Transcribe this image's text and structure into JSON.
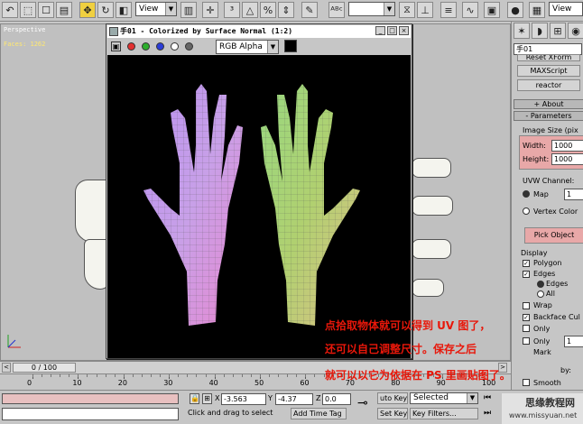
{
  "toolbar": {
    "view_dropdown": "View",
    "right_view_dropdown": "View"
  },
  "viewport": {
    "label": "Perspective",
    "faces": "Faces: 1262"
  },
  "render_window": {
    "title": "手01 - Colorized by Surface Normal (1:2)",
    "channel_dropdown": "RGB Alpha",
    "channel_dots": [
      "#e23030",
      "#2cae2c",
      "#2a3cd8",
      "#ffffff",
      "#666666"
    ]
  },
  "panel": {
    "object_name": "手01",
    "buttons": [
      "Reset XForm",
      "MAXScript",
      "reactor"
    ],
    "about_label": "About",
    "parameters_label": "Parameters",
    "image_size_label": "Image Size (pix",
    "width_label": "Width:",
    "width_value": "1000",
    "height_label": "Height:",
    "height_value": "1000",
    "uvw_channel_label": "UVW Channel:",
    "map_label": "Map",
    "map_value": "1",
    "vertex_color_label": "Vertex Color",
    "pick_object_label": "Pick Object",
    "display_label": "Display",
    "polygon_label": "Polygon",
    "edges_label": "Edges",
    "edges_sub_label": "Edges",
    "all_label": "All",
    "wrap_label": "Wrap",
    "backface_label": "Backface Cul",
    "only_label1": "Only",
    "only_label2": "Only",
    "only_value": "1",
    "mark_label": "Mark",
    "by_label": "by:",
    "smooth_label": "Smooth"
  },
  "timeline": {
    "frame": "0 / 100",
    "ticks": [
      "0",
      "10",
      "20",
      "30",
      "40",
      "50",
      "60",
      "70",
      "80",
      "90",
      "100"
    ]
  },
  "status": {
    "x_label": "X",
    "x_value": "-3.563",
    "y_label": "Y",
    "y_value": "-4.37",
    "z_label": "Z",
    "z_value": "0.0",
    "prompt": "Click and drag to select",
    "add_time_tag": "Add Time Tag",
    "auto_key": "uto Key",
    "selected": "Selected",
    "set_key": "Set Key",
    "key_filters": "Key Filters..."
  },
  "annotation": {
    "line1": "点拾取物体就可以得到 UV 图了，",
    "line2": "还可以自己调整尺寸。保存之后",
    "line3": "就可以以它为依据在 PS 里画贴图了。"
  },
  "watermark": {
    "cn": "思缘教程网",
    "url": "www.missyuan.net"
  },
  "colors": {
    "title_red": "#e8170a",
    "highlight_pink": "#e8a8a8",
    "canvas_bg": "#000000"
  }
}
